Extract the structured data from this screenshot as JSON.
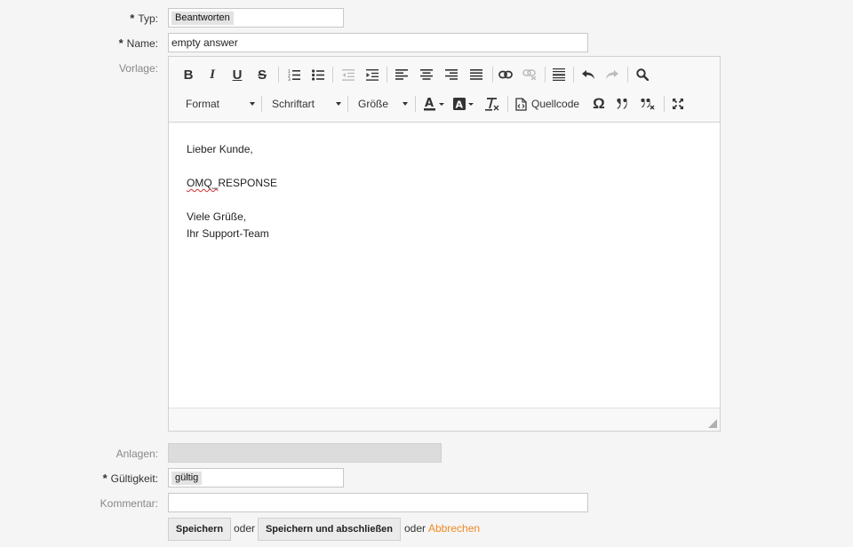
{
  "form": {
    "typ": {
      "label": "Typ:",
      "required": true,
      "value": "Beantworten"
    },
    "name": {
      "label": "Name:",
      "required": true,
      "value": "empty answer"
    },
    "vorlage": {
      "label": "Vorlage:"
    },
    "anlagen": {
      "label": "Anlagen:"
    },
    "gueltigkeit": {
      "label": "Gültigkeit:",
      "required": true,
      "value": "gültig"
    },
    "kommentar": {
      "label": "Kommentar:",
      "value": ""
    },
    "required_marker": "*"
  },
  "toolbar": {
    "format_label": "Format",
    "font_label": "Schriftart",
    "size_label": "Größe",
    "source_label": "Quellcode",
    "bold_glyph": "B",
    "italic_glyph": "I",
    "underline_glyph": "U",
    "strike_glyph": "S",
    "special_char_glyph": "Ω"
  },
  "editor": {
    "lines": {
      "greeting": "Lieber Kunde,",
      "placeholder_underlined": "OMQ_",
      "placeholder_rest": "RESPONSE",
      "closing": "Viele Grüße,",
      "signature": "Ihr Support-Team"
    }
  },
  "actions": {
    "save": "Speichern",
    "or1": "oder",
    "save_close": "Speichern und abschließen",
    "or2": "oder",
    "cancel": "Abbrechen"
  },
  "colors": {
    "accent_link": "#f08a24",
    "background": "#f5f5f5",
    "spellcheck": "#d03030"
  }
}
